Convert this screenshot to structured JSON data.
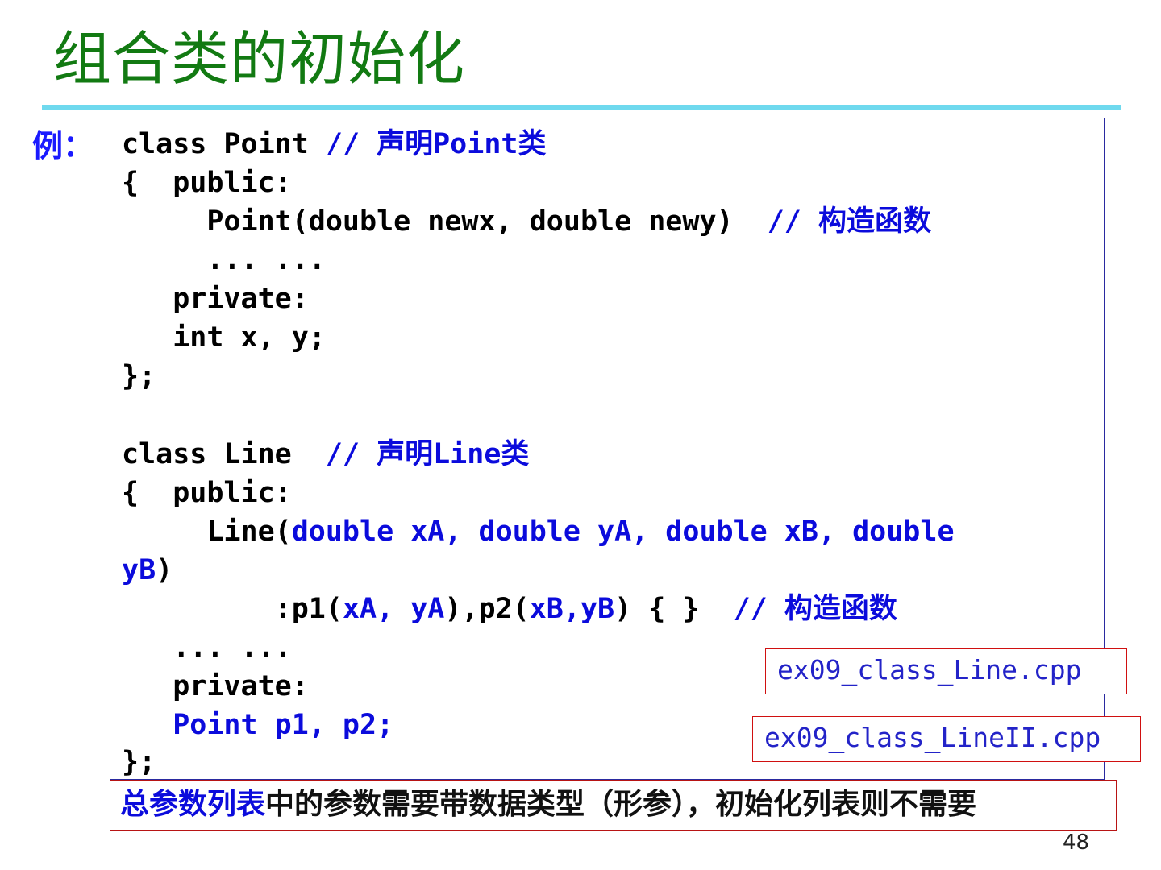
{
  "title": "组合类的初始化",
  "example_label": "例：",
  "code": {
    "l1_code": "class Point ",
    "l1_comment": "// ",
    "l1_comment_text": "声明",
    "l1_comment_name": "Point",
    "l1_comment_suffix": "类",
    "l2": "{  public:",
    "l3_code": "     Point(double newx, double newy)  ",
    "l3_comment": "// ",
    "l3_comment_text": "构造函数",
    "l4": "     ... ...",
    "l5": "   private:",
    "l6": "   int x, y;",
    "l7": "};",
    "l9_code": "class Line  ",
    "l9_comment": "// ",
    "l9_comment_text": "声明",
    "l9_comment_name": "Line",
    "l9_comment_suffix": "类",
    "l10": "{  public:",
    "l11_pre": "     Line(",
    "l11_params": "double xA, double yA, double xB, double",
    "l12_params": "yB",
    "l12_post": ")",
    "l13_pre": "         :p1(",
    "l13_a": "xA, yA",
    "l13_mid": "),p2(",
    "l13_b": "xB,yB",
    "l13_post": ") { }  ",
    "l13_comment": "// ",
    "l13_comment_text": "构造函数",
    "l14": "   ... ...",
    "l15": "   private:",
    "l16": "   Point p1, p2;",
    "l17": "};"
  },
  "files": [
    "ex09_class_Line.cpp",
    "ex09_class_LineII.cpp"
  ],
  "note": {
    "emphasis": "总参数列表",
    "rest": "中的参数需要带数据类型（形参），初始化列表则不需要"
  },
  "page_number": "48"
}
